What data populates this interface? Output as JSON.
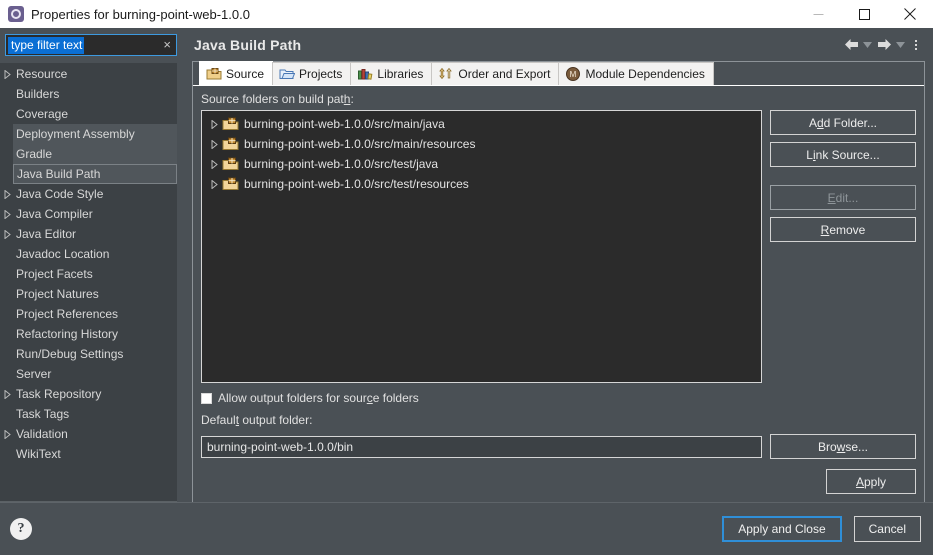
{
  "window": {
    "title": "Properties for burning-point-web-1.0.0",
    "icon": "properties-gear-icon",
    "controls": {
      "minimize": "minimize-icon",
      "maximize": "maximize-icon",
      "close": "close-icon"
    }
  },
  "filter": {
    "value": "type filter text",
    "placeholder": "type filter text",
    "clear": "×"
  },
  "sidebar": {
    "items": [
      {
        "label": "Resource",
        "expandable": true,
        "state": "normal"
      },
      {
        "label": "Builders",
        "expandable": false,
        "state": "normal"
      },
      {
        "label": "Coverage",
        "expandable": false,
        "state": "normal"
      },
      {
        "label": "Deployment Assembly",
        "expandable": false,
        "state": "hover"
      },
      {
        "label": "Gradle",
        "expandable": false,
        "state": "hover"
      },
      {
        "label": "Java Build Path",
        "expandable": false,
        "state": "selected"
      },
      {
        "label": "Java Code Style",
        "expandable": true,
        "state": "normal"
      },
      {
        "label": "Java Compiler",
        "expandable": true,
        "state": "normal"
      },
      {
        "label": "Java Editor",
        "expandable": true,
        "state": "normal"
      },
      {
        "label": "Javadoc Location",
        "expandable": false,
        "state": "normal"
      },
      {
        "label": "Project Facets",
        "expandable": false,
        "state": "normal"
      },
      {
        "label": "Project Natures",
        "expandable": false,
        "state": "normal"
      },
      {
        "label": "Project References",
        "expandable": false,
        "state": "normal"
      },
      {
        "label": "Refactoring History",
        "expandable": false,
        "state": "normal"
      },
      {
        "label": "Run/Debug Settings",
        "expandable": false,
        "state": "normal"
      },
      {
        "label": "Server",
        "expandable": false,
        "state": "normal"
      },
      {
        "label": "Task Repository",
        "expandable": true,
        "state": "normal"
      },
      {
        "label": "Task Tags",
        "expandable": false,
        "state": "normal"
      },
      {
        "label": "Validation",
        "expandable": true,
        "state": "normal"
      },
      {
        "label": "WikiText",
        "expandable": false,
        "state": "normal"
      }
    ]
  },
  "page": {
    "title": "Java Build Path",
    "nav": {
      "back": "back-arrow-icon",
      "back_menu": "chevron-down-icon",
      "forward": "forward-arrow-icon",
      "forward_menu": "chevron-down-icon",
      "menu": "view-menu-icon"
    }
  },
  "tabs": [
    {
      "label": "Source",
      "icon": "source-folder-icon",
      "active": true
    },
    {
      "label": "Projects",
      "icon": "projects-folder-icon",
      "active": false
    },
    {
      "label": "Libraries",
      "icon": "libraries-books-icon",
      "active": false
    },
    {
      "label": "Order and Export",
      "icon": "order-export-arrows-icon",
      "active": false
    },
    {
      "label": "Module Dependencies",
      "icon": "module-dependencies-icon",
      "active": false
    }
  ],
  "source_tab": {
    "list_label_pre": "Source folders on build pat",
    "list_label_mnemonic": "h",
    "list_label_post": ":",
    "folders": [
      "burning-point-web-1.0.0/src/main/java",
      "burning-point-web-1.0.0/src/main/resources",
      "burning-point-web-1.0.0/src/test/java",
      "burning-point-web-1.0.0/src/test/resources"
    ],
    "buttons": [
      {
        "pre": "A",
        "mnemonic": "d",
        "post": "d Folder...",
        "name": "add-folder-button",
        "enabled": true
      },
      {
        "pre": "L",
        "mnemonic": "i",
        "post": "nk Source...",
        "name": "link-source-button",
        "enabled": true
      },
      {
        "pre": "",
        "mnemonic": "E",
        "post": "dit...",
        "name": "edit-button",
        "enabled": false
      },
      {
        "pre": "",
        "mnemonic": "R",
        "post": "emove",
        "name": "remove-button",
        "enabled": true
      }
    ],
    "allow_output_pre": "Allow output folders for sour",
    "allow_output_mnemonic": "c",
    "allow_output_post": "e folders",
    "allow_output_checked": false,
    "default_output_pre": "Defaul",
    "default_output_mnemonic": "t",
    "default_output_post": " output folder:",
    "default_output_value": "burning-point-web-1.0.0/bin",
    "browse_pre": "Bro",
    "browse_mnemonic": "w",
    "browse_post": "se...",
    "apply_mnemonic": "A",
    "apply_post": "pply"
  },
  "footer": {
    "help": "?",
    "apply_and_close": "Apply and Close",
    "cancel": "Cancel"
  },
  "colors": {
    "window_bg": "#4a5055",
    "list_bg": "#2b2b2b",
    "tree_bg": "#3c4145",
    "accent_focus": "#2f8fd8",
    "selection_blue": "#0b6fd4",
    "text": "#e0e0e0"
  }
}
